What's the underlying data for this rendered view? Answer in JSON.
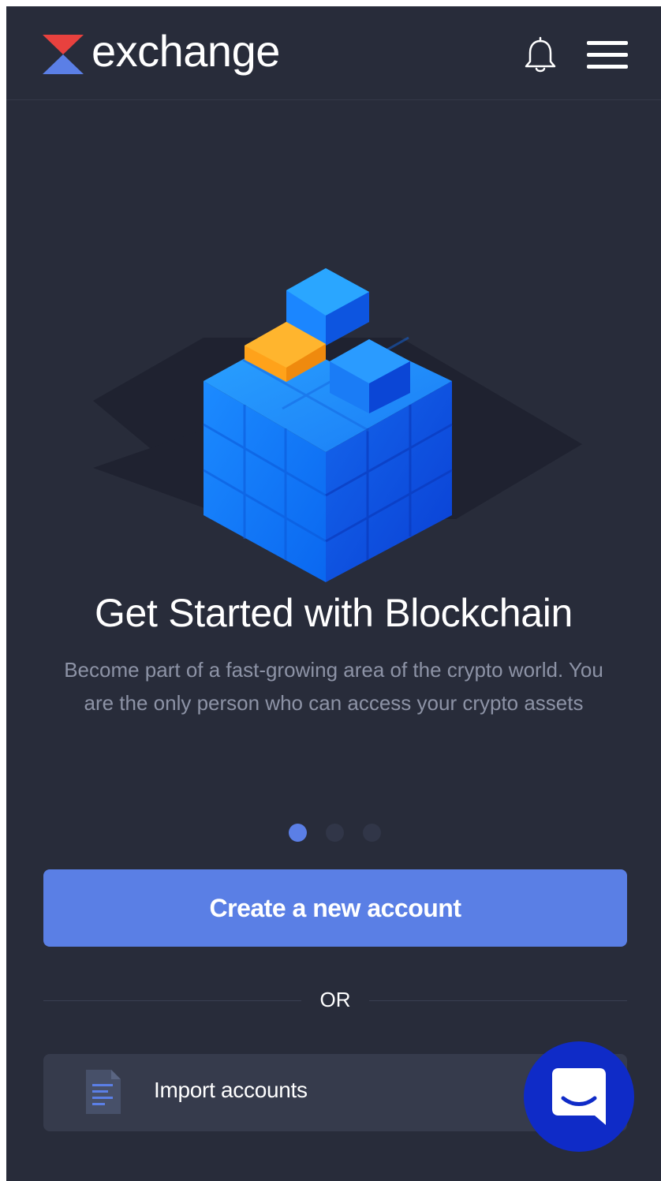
{
  "header": {
    "brand": "exchange",
    "logo_icon": "exchange-logo-icon",
    "notification_icon": "bell-icon",
    "menu_icon": "hamburger-menu-icon"
  },
  "hero": {
    "illustration_icon": "blockchain-cube-icon",
    "title": "Get Started with Blockchain",
    "subtitle": "Become part of a fast-growing area of the crypto world. You are the only person who can access your crypto assets"
  },
  "carousel": {
    "total": 3,
    "active_index": 0
  },
  "actions": {
    "create_label": "Create a new account",
    "or_label": "OR",
    "import_label": "Import accounts",
    "import_icon": "document-icon"
  },
  "chat": {
    "icon": "chat-bubble-icon"
  },
  "colors": {
    "background": "#282c3a",
    "accent": "#5a7fe5",
    "secondary_button": "#363b4c",
    "chat_button": "#0f2bc7",
    "logo_red": "#e8413e",
    "logo_blue": "#5b7fe6",
    "cube_orange": "#ffa21a"
  }
}
